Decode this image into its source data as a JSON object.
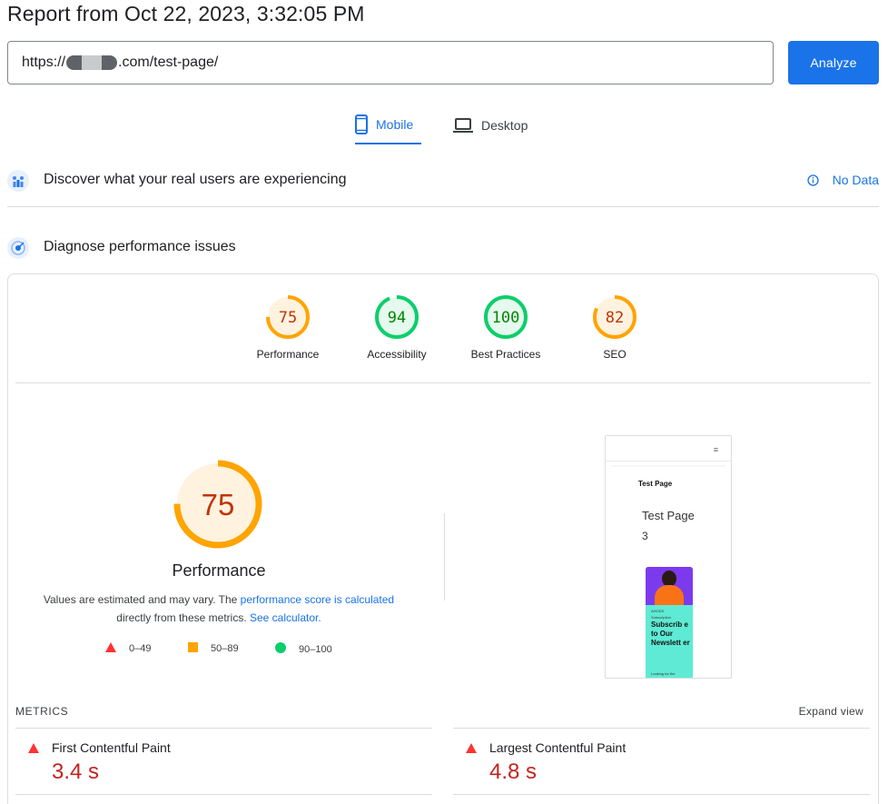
{
  "header": {
    "title": "Report from Oct 22, 2023, 3:32:05 PM"
  },
  "url_bar": {
    "prefix": "https://",
    "suffix": ".com/test-page/",
    "analyze_label": "Analyze"
  },
  "tabs": [
    {
      "label": "Mobile",
      "active": true
    },
    {
      "label": "Desktop",
      "active": false
    }
  ],
  "crux": {
    "title": "Discover what your real users are experiencing",
    "status": "No Data"
  },
  "diagnose": {
    "title": "Diagnose performance issues"
  },
  "category_scores": [
    {
      "label": "Performance",
      "score": "75",
      "level": "average"
    },
    {
      "label": "Accessibility",
      "score": "94",
      "level": "pass"
    },
    {
      "label": "Best Practices",
      "score": "100",
      "level": "pass"
    },
    {
      "label": "SEO",
      "score": "82",
      "level": "average"
    }
  ],
  "performance": {
    "score": "75",
    "label": "Performance",
    "desc_1": "Values are estimated and may vary. The ",
    "desc_link_1": "performance score is calculated",
    "desc_2": "directly from these metrics. ",
    "desc_link_2": "See calculator."
  },
  "legend": [
    {
      "label": "0–49",
      "level": "fail"
    },
    {
      "label": "50–89",
      "level": "average"
    },
    {
      "label": "90–100",
      "level": "pass"
    }
  ],
  "screenshot": {
    "menu_glyph": "≡",
    "brand": "Test Page",
    "page_title": "Test Page",
    "page_number": "3",
    "promo_line_1": "AHODS",
    "promo_line_2": "Subscription",
    "promo_heading": "Subscrib e to Our Newslett er",
    "promo_small": "Looking for the"
  },
  "metrics": {
    "label": "METRICS",
    "expand_label": "Expand view",
    "items": [
      {
        "name": "First Contentful Paint",
        "value": "3.4 s",
        "level": "fail"
      },
      {
        "name": "Largest Contentful Paint",
        "value": "4.8 s",
        "level": "fail"
      }
    ]
  },
  "colors": {
    "accent": "#1a73e8",
    "fail": "#ff3333",
    "fail_text": "#c5221f",
    "average": "#ffa400",
    "average_text": "#c33300",
    "pass": "#0cce6b",
    "pass_text": "#008800"
  }
}
